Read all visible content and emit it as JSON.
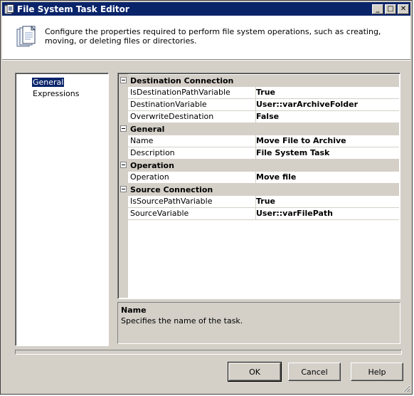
{
  "window": {
    "title": "File System Task Editor",
    "minimize": "_",
    "maximize": "□",
    "close": "✕"
  },
  "header": {
    "description": "Configure the properties required to perform file system operations, such as creating, moving, or deleting files or directories.",
    "icon": "files-stack-icon"
  },
  "nav": {
    "items": [
      {
        "label": "General",
        "selected": true
      },
      {
        "label": "Expressions",
        "selected": false
      }
    ]
  },
  "grid": {
    "categories": [
      {
        "label": "Destination Connection",
        "properties": [
          {
            "name": "IsDestinationPathVariable",
            "value": "True"
          },
          {
            "name": "DestinationVariable",
            "value": "User::varArchiveFolder"
          },
          {
            "name": "OverwriteDestination",
            "value": "False"
          }
        ]
      },
      {
        "label": "General",
        "properties": [
          {
            "name": "Name",
            "value": "Move File to Archive"
          },
          {
            "name": "Description",
            "value": "File System Task"
          }
        ]
      },
      {
        "label": "Operation",
        "properties": [
          {
            "name": "Operation",
            "value": "Move file"
          }
        ]
      },
      {
        "label": "Source Connection",
        "properties": [
          {
            "name": "IsSourcePathVariable",
            "value": "True"
          },
          {
            "name": "SourceVariable",
            "value": "User::varFilePath"
          }
        ]
      }
    ]
  },
  "description_panel": {
    "title": "Name",
    "text": "Specifies the name of the task."
  },
  "buttons": {
    "ok": "OK",
    "cancel": "Cancel",
    "help": "Help"
  },
  "colors": {
    "titlebar": "#0a246a",
    "face": "#d4d0c8",
    "selection": "#0a246a"
  }
}
